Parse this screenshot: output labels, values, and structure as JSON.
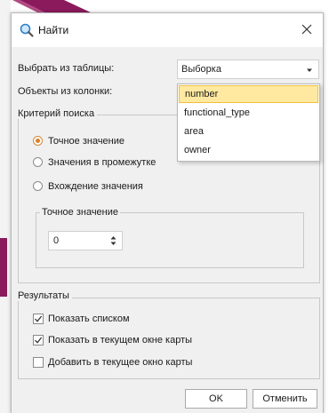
{
  "window": {
    "title": "Найти",
    "title_icon": "search-icon",
    "close_icon": "close-icon"
  },
  "table_select": {
    "label": "Выбрать из таблицы:",
    "value": "Выборка"
  },
  "column_select": {
    "label": "Объекты из колонки:",
    "options": [
      "number",
      "functional_type",
      "area",
      "owner"
    ],
    "highlighted": "number"
  },
  "criteria": {
    "title": "Критерий поиска",
    "options": [
      "Точное значение",
      "Значения в промежутке",
      "Вхождение значения"
    ],
    "selected": "Точное значение",
    "exact_group": {
      "title": "Точное значение",
      "value": "0"
    }
  },
  "results": {
    "title": "Результаты",
    "options": [
      {
        "label": "Показать списком",
        "checked": true
      },
      {
        "label": "Показать в текущем окне карты",
        "checked": true
      },
      {
        "label": "Добавить в текущее окно карты",
        "checked": false
      }
    ]
  },
  "buttons": {
    "ok": "OK",
    "cancel": "Отменить"
  },
  "colors": {
    "accent": "#e07e26",
    "highlight": "#ffe9a0",
    "background_accent": "#8b1a5c"
  }
}
